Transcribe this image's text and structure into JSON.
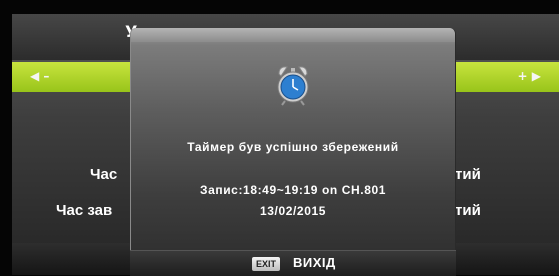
{
  "background_menu": {
    "title_fragment": "У",
    "left_arrow": "◀ –",
    "right_arrow": "+ ▶",
    "row1_left": "Час",
    "row1_right": "тий",
    "row2_left": "Час зав",
    "row2_right": "тий"
  },
  "dialog": {
    "icon": "alarm-clock-icon",
    "message": "Таймер був успішно збережений",
    "record_info": "Запис:18:49~19:19 on CH.801",
    "date": "13/02/2015",
    "exit_key": "EXIT",
    "exit_label": "ВИХІД"
  },
  "colors": {
    "accent_green": "#b5d62a",
    "clock_blue": "#2d7fd0"
  }
}
